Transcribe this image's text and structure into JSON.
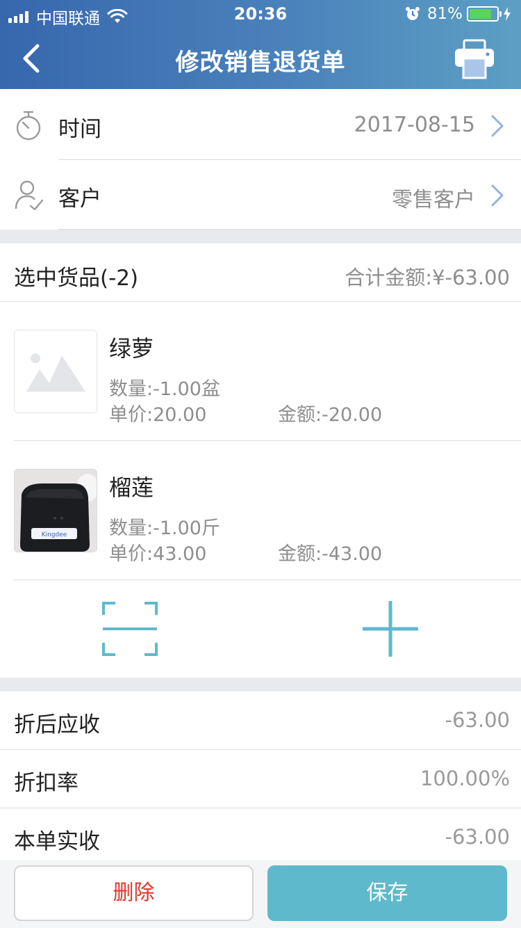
{
  "status_bar": {
    "carrier": "中国联通",
    "time": "20:36",
    "battery_percent": "81%",
    "battery_level": 0.81
  },
  "nav": {
    "title": "修改销售退货单"
  },
  "form": {
    "date_label": "时间",
    "date_value": "2017-08-15",
    "customer_label": "客户",
    "customer_value": "零售客户"
  },
  "selection": {
    "label": "选中货品(-2)",
    "total": "合计金额:¥-63.00"
  },
  "items": [
    {
      "name": "绿萝",
      "qty": "数量:-1.00盆",
      "price": "单价:20.00",
      "amount": "金额:-20.00",
      "image": "placeholder-image-icon"
    },
    {
      "name": "榴莲",
      "qty": "数量:-1.00斤",
      "price": "单价:43.00",
      "amount": "金额:-43.00",
      "image": "printer-photo"
    }
  ],
  "summary": {
    "after_discount_label": "折后应收",
    "after_discount_value": "-63.00",
    "discount_rate_label": "折扣率",
    "discount_rate_value": "100.00%",
    "actual_label": "本单实收",
    "actual_value": "-63.00"
  },
  "buttons": {
    "delete": "删除",
    "save": "保存"
  },
  "colors": {
    "header_start": "#3767ad",
    "header_end": "#5d9fc4",
    "accent": "#5fb9cc",
    "delete_text": "#e0362c",
    "chevron": "#8fb2e0"
  }
}
